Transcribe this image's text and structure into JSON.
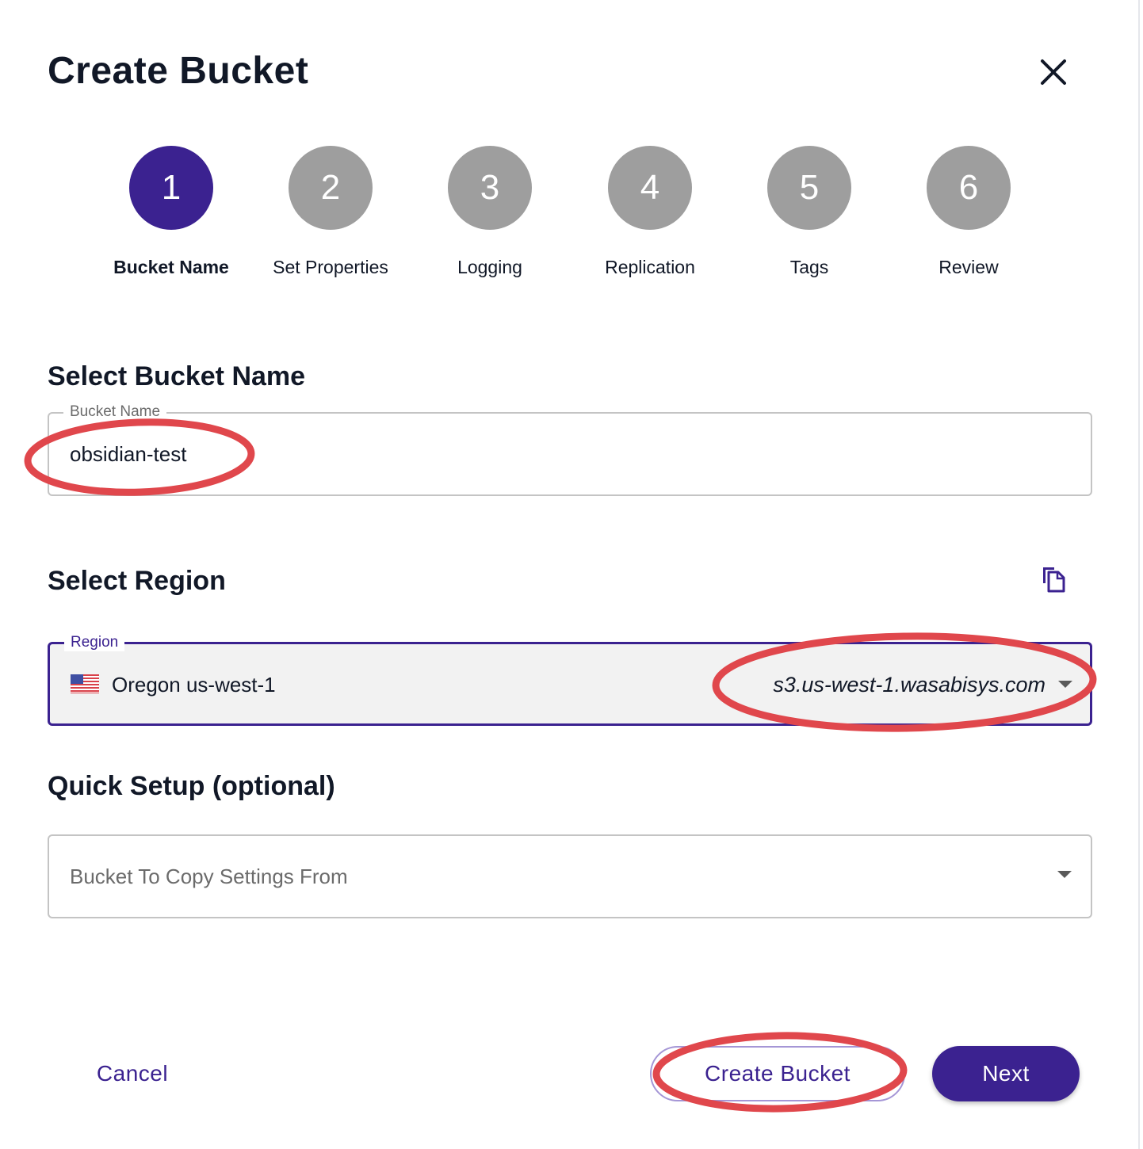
{
  "dialog": {
    "title": "Create Bucket",
    "close_icon": "close-icon"
  },
  "steps": [
    {
      "number": "1",
      "label": "Bucket Name",
      "active": true
    },
    {
      "number": "2",
      "label": "Set Properties",
      "active": false
    },
    {
      "number": "3",
      "label": "Logging",
      "active": false
    },
    {
      "number": "4",
      "label": "Replication",
      "active": false
    },
    {
      "number": "5",
      "label": "Tags",
      "active": false
    },
    {
      "number": "6",
      "label": "Review",
      "active": false
    }
  ],
  "bucket_name_section": {
    "title": "Select Bucket Name",
    "field_label": "Bucket Name",
    "value": "obsidian-test"
  },
  "region_section": {
    "title": "Select Region",
    "copy_icon": "copy-icon",
    "field_label": "Region",
    "flag_icon": "us-flag-icon",
    "region_name": "Oregon us-west-1",
    "endpoint": "s3.us-west-1.wasabisys.com"
  },
  "quick_setup_section": {
    "title": "Quick Setup (optional)",
    "placeholder": "Bucket To Copy Settings From"
  },
  "footer": {
    "cancel_label": "Cancel",
    "create_label": "Create Bucket",
    "next_label": "Next"
  },
  "colors": {
    "accent": "#3b2290",
    "step_inactive": "#9e9e9e",
    "annotation": "#e0474c"
  }
}
